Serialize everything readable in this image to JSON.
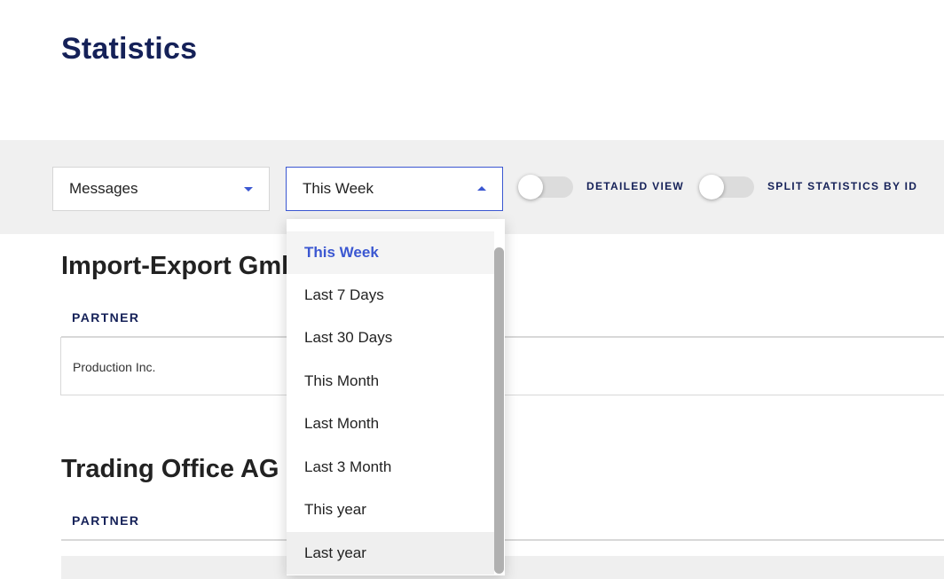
{
  "page": {
    "title": "Statistics"
  },
  "filters": {
    "metric_select": {
      "value": "Messages"
    },
    "period_select": {
      "value": "This Week"
    },
    "detailed_view": {
      "label": "DETAILED VIEW",
      "on": false
    },
    "split_by_id": {
      "label": "SPLIT STATISTICS BY ID",
      "on": false
    }
  },
  "period_dropdown": {
    "options": [
      "This Week",
      "Last 7 Days",
      "Last 30 Days",
      "This Month",
      "Last Month",
      "Last 3 Month",
      "This year",
      "Last year"
    ],
    "selected": "This Week",
    "hovered": "Last year"
  },
  "sections": [
    {
      "title": "Import-Export GmbH",
      "column_header": "PARTNER",
      "rows": [
        "Production Inc."
      ]
    },
    {
      "title": "Trading Office AG",
      "column_header": "PARTNER",
      "rows": []
    }
  ],
  "colors": {
    "brand_navy": "#152158",
    "accent_blue": "#3b57d1"
  }
}
